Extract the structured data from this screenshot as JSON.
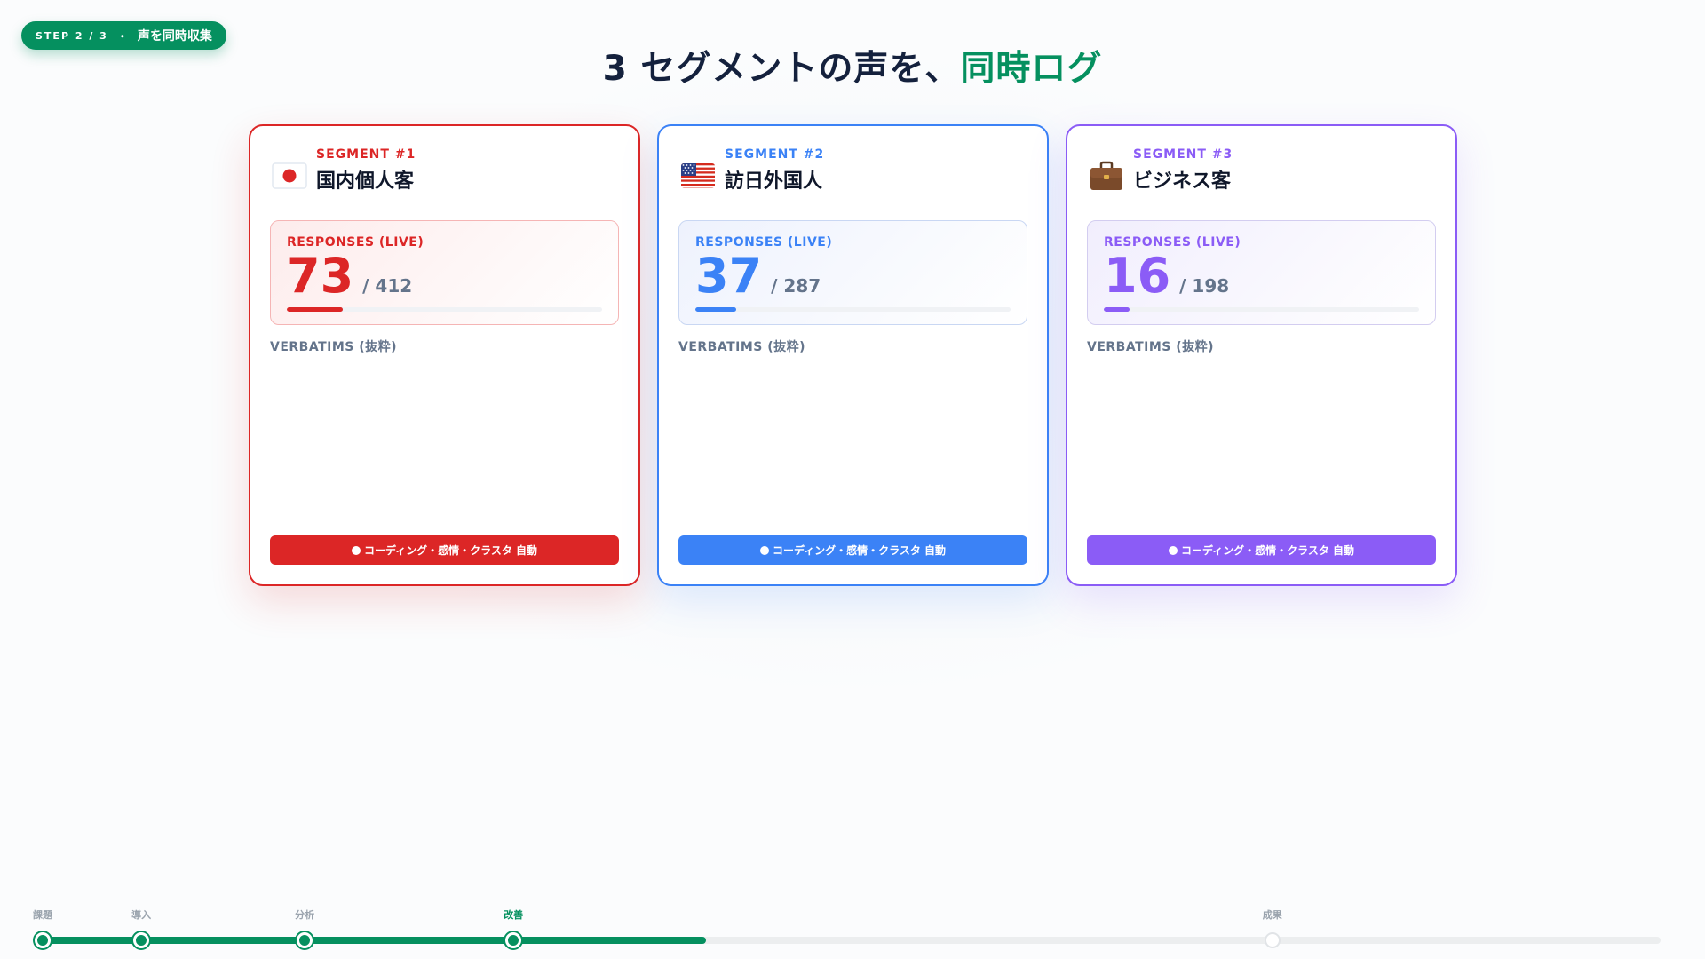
{
  "step_pill": {
    "step": "STEP 2 / 3",
    "separator": "・",
    "phase": "声を同時収集"
  },
  "headline": {
    "prefix": "3 セグメントの声を、",
    "accent": "同時ログ",
    "accent_color": "#05905f"
  },
  "segments": [
    {
      "number": "SEGMENT #1",
      "name": "国内個人客",
      "icon": "japan-flag-icon",
      "color": "#dc2626",
      "responses_label": "RESPONSES (LIVE)",
      "count": "73",
      "total": "412",
      "total_display": "/ 412",
      "progress": 0.177,
      "verbatims_label": "VERBATIMS (抜粋)",
      "status": "コーディング・感情・クラスタ 自動"
    },
    {
      "number": "SEGMENT #2",
      "name": "訪日外国人",
      "icon": "us-flag-icon",
      "color": "#3b82f6",
      "responses_label": "RESPONSES (LIVE)",
      "count": "37",
      "total": "287",
      "total_display": "/ 287",
      "progress": 0.129,
      "verbatims_label": "VERBATIMS (抜粋)",
      "status": "コーディング・感情・クラスタ 自動"
    },
    {
      "number": "SEGMENT #3",
      "name": "ビジネス客",
      "icon": "briefcase-icon",
      "color": "#8b5cf6",
      "responses_label": "RESPONSES (LIVE)",
      "count": "16",
      "total": "198",
      "total_display": "/ 198",
      "progress": 0.081,
      "verbatims_label": "VERBATIMS (抜粋)",
      "status": "コーディング・感情・クラスタ 自動"
    }
  ],
  "timeline": {
    "progress": 0.41,
    "accent_color": "#05905f",
    "stages": [
      {
        "label": "課題",
        "done": true,
        "current": false,
        "position": 0.0
      },
      {
        "label": "導入",
        "done": true,
        "current": false,
        "position": 0.061
      },
      {
        "label": "分析",
        "done": true,
        "current": false,
        "position": 0.162
      },
      {
        "label": "改善",
        "done": true,
        "current": true,
        "position": 0.291
      },
      {
        "label": "成果",
        "done": false,
        "current": false,
        "position": 0.76
      }
    ]
  }
}
